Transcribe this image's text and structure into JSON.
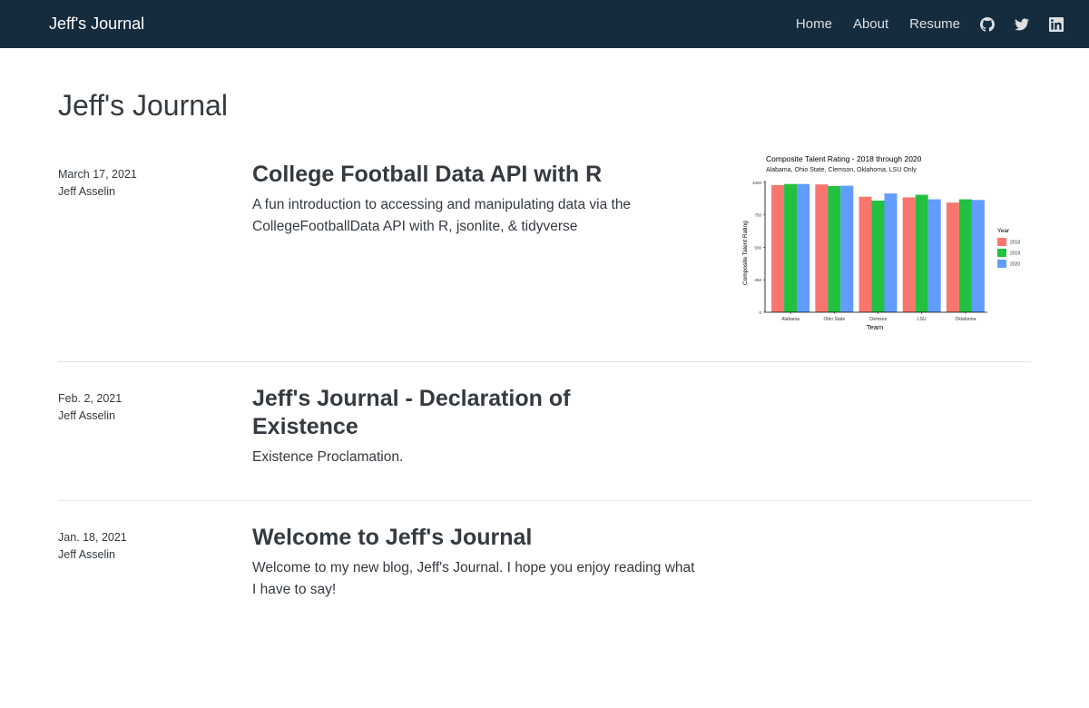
{
  "navbar": {
    "brand": "Jeff's Journal",
    "links": [
      "Home",
      "About",
      "Resume"
    ],
    "icons": [
      "github-icon",
      "twitter-icon",
      "linkedin-icon"
    ]
  },
  "page": {
    "title": "Jeff's Journal"
  },
  "posts": [
    {
      "date": "March 17, 2021",
      "author": "Jeff Asselin",
      "title": "College Football Data API with R",
      "summary": "A fun introduction to accessing and manipulating data via the CollegeFootballData API with R, jsonlite, & tidyverse",
      "thumbnail": {
        "title": "Composite Talent Rating - 2018 through 2020",
        "subtitle": "Alabama, Ohio State, Clemson, Oklahoma, LSU Only",
        "xlabel": "Team",
        "ylabel": "Composite Talent Rating",
        "legend_title": "Year",
        "categories": [
          "Alabama",
          "Ohio State",
          "Clemson",
          "LSU",
          "Oklahoma"
        ],
        "series": [
          {
            "name": "2018",
            "color": "#f8766d",
            "values": [
              980,
              985,
              890,
              885,
              845
            ]
          },
          {
            "name": "2019",
            "color": "#22c040",
            "values": [
              988,
              972,
              860,
              905,
              870
            ]
          },
          {
            "name": "2020",
            "color": "#619cff",
            "values": [
              988,
              975,
              915,
              870,
              865
            ]
          }
        ],
        "yticks": [
          "0",
          "250",
          "500",
          "750",
          "1000"
        ],
        "ylim": [
          0,
          1000
        ]
      }
    },
    {
      "date": "Feb. 2, 2021",
      "author": "Jeff Asselin",
      "title": "Jeff's Journal - Declaration of Existence",
      "summary": "Existence Proclamation."
    },
    {
      "date": "Jan. 18, 2021",
      "author": "Jeff Asselin",
      "title": "Welcome to Jeff's Journal",
      "summary": "Welcome to my new blog, Jeff's Journal. I hope you enjoy reading what I have to say!"
    }
  ]
}
